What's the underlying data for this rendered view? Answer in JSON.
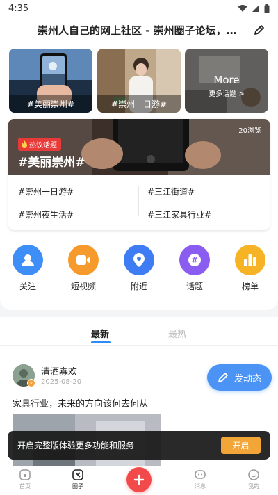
{
  "status_bar": {
    "time": "4:35"
  },
  "header": {
    "title": "崇州人自己的网上社区 - 崇州圈子论坛，交...",
    "edit_icon": "edit-icon"
  },
  "topic_tiles": [
    {
      "label": "#美丽崇州#"
    },
    {
      "label": "#崇州一日游#"
    },
    {
      "more_title": "More",
      "more_subtitle": "更多话题 >"
    }
  ],
  "hot_topic": {
    "badge": "热议话题",
    "views": "20浏览",
    "title": "#美丽崇州#",
    "links": [
      "#崇州一日游#",
      "#三江街道#",
      "#崇州夜生活#",
      "#三江家具行业#"
    ]
  },
  "quick_nav": [
    {
      "label": "关注",
      "color": "#3d8ef7"
    },
    {
      "label": "短视频",
      "color": "#f79a2c"
    },
    {
      "label": "附近",
      "color": "#3d7cf2"
    },
    {
      "label": "话题",
      "color": "#8b5cf0"
    },
    {
      "label": "榜单",
      "color": "#f5b325"
    }
  ],
  "feed_tabs": {
    "active": "最新",
    "inactive": "最热"
  },
  "post": {
    "author": "清酒寡欢",
    "date": "2025-08-20",
    "text": "家具行业，未来的方向该何去何从"
  },
  "publish_button": {
    "label": "发动态"
  },
  "promo": {
    "text": "开启完整版体验更多功能和服务",
    "button": "开启"
  },
  "bottom_nav": [
    {
      "label": "首页",
      "icon": "home-icon"
    },
    {
      "label": "圈子",
      "icon": "circle-icon"
    },
    {
      "label": "",
      "icon": "plus-icon"
    },
    {
      "label": "消息",
      "icon": "message-icon"
    },
    {
      "label": "我的",
      "icon": "profile-icon"
    }
  ],
  "colors": {
    "accent": "#2f8cf7",
    "hot_red": "#e93a3a",
    "fab_red": "#f24a4a",
    "promo_orange": "#f2a638"
  }
}
